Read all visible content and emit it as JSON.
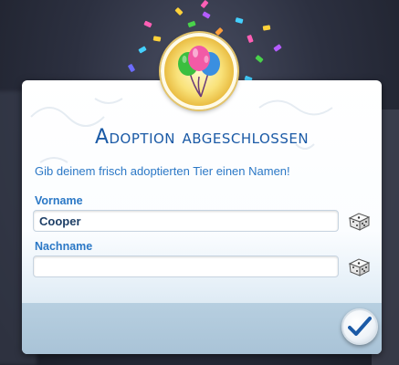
{
  "dialog": {
    "title": "Adoption abgeschlossen",
    "subtitle": "Gib deinem frisch adoptierten Tier einen Namen!",
    "first_name_label": "Vorname",
    "first_name_value": "Cooper",
    "last_name_label": "Nachname",
    "last_name_value": "",
    "confirm_icon": "checkmark-icon",
    "randomize_icon": "dice-icon",
    "badge_icon": "balloons-icon"
  },
  "colors": {
    "accent": "#1b5aa6",
    "label": "#2b78c6",
    "badge": "#f9e27a"
  }
}
